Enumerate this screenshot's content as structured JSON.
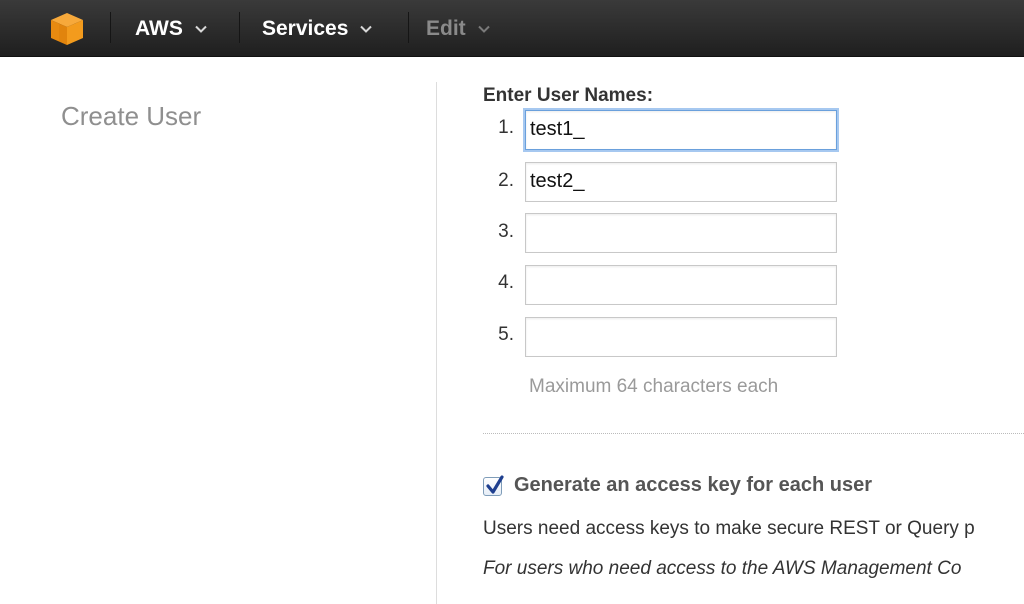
{
  "nav": {
    "logo_icon": "aws-cube-icon",
    "items": [
      {
        "label": "AWS",
        "has_dropdown": true,
        "enabled": true
      },
      {
        "label": "Services",
        "has_dropdown": true,
        "enabled": true
      },
      {
        "label": "Edit",
        "has_dropdown": true,
        "enabled": false
      }
    ],
    "colors": {
      "bar": "#2b2b2b",
      "logo": "#f7981d",
      "disabled_text": "#8a8a8a"
    }
  },
  "page": {
    "title": "Create User"
  },
  "form": {
    "section_label": "Enter User Names:",
    "rows": [
      {
        "number": "1.",
        "value": "test1_",
        "focused": true
      },
      {
        "number": "2.",
        "value": "test2_",
        "focused": false
      },
      {
        "number": "3.",
        "value": "",
        "focused": false
      },
      {
        "number": "4.",
        "value": "",
        "focused": false
      },
      {
        "number": "5.",
        "value": "",
        "focused": false
      }
    ],
    "hint": "Maximum 64 characters each",
    "focus_color": "#6aa0dc"
  },
  "access_key": {
    "checked": true,
    "label": "Generate an access key for each user",
    "description": "Users need access keys to make secure REST or Query p",
    "note": "For users who need access to the AWS Management Co"
  }
}
